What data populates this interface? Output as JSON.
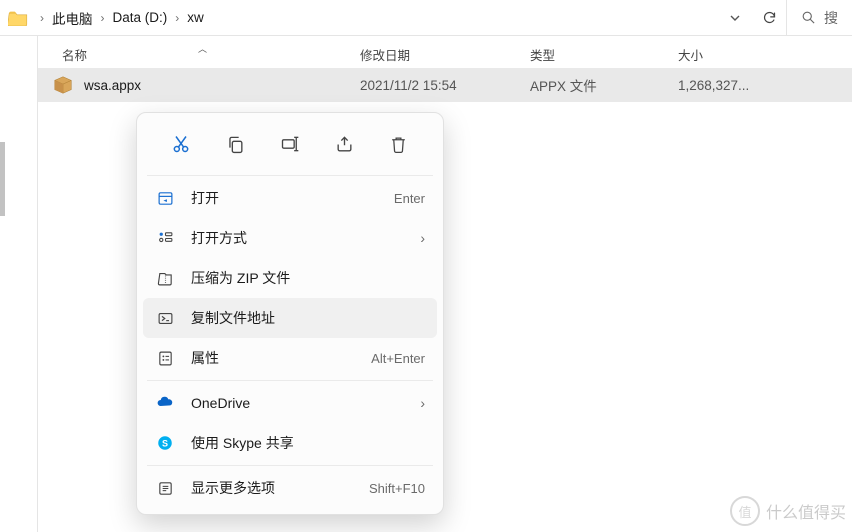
{
  "breadcrumb": {
    "root": "此电脑",
    "drive": "Data (D:)",
    "folder": "xw"
  },
  "toolbar": {
    "search_label": "搜"
  },
  "columns": {
    "name": "名称",
    "date": "修改日期",
    "type": "类型",
    "size": "大小"
  },
  "file": {
    "name": "wsa.appx",
    "date": "2021/11/2 15:54",
    "type": "APPX 文件",
    "size": "1,268,327..."
  },
  "context_menu": {
    "open": {
      "label": "打开",
      "accel": "Enter"
    },
    "open_with": {
      "label": "打开方式"
    },
    "compress_zip": {
      "label": "压缩为 ZIP 文件"
    },
    "copy_path": {
      "label": "复制文件地址"
    },
    "properties": {
      "label": "属性",
      "accel": "Alt+Enter"
    },
    "onedrive": {
      "label": "OneDrive"
    },
    "skype": {
      "label": "使用 Skype 共享"
    },
    "more": {
      "label": "显示更多选项",
      "accel": "Shift+F10"
    }
  },
  "watermark": {
    "text": "什么值得买"
  }
}
